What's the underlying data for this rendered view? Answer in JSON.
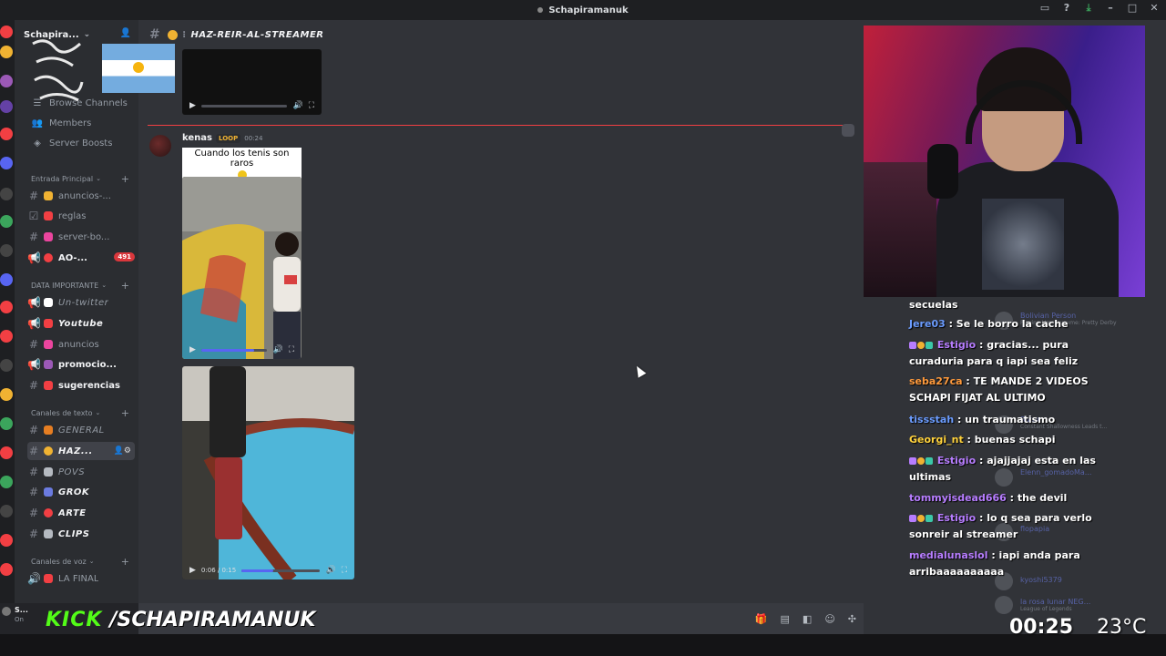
{
  "window": {
    "title": "Schapiramanuk"
  },
  "server": {
    "name": "Schapira...",
    "chevron": "chevron-down-icon"
  },
  "nav": [
    {
      "label": "Browse Channels",
      "icon": "browse-icon"
    },
    {
      "label": "Members",
      "icon": "members-icon"
    },
    {
      "label": "Server Boosts",
      "icon": "boost-icon"
    }
  ],
  "categories": {
    "entrada": "Entrada Principal",
    "importante": "DATA IMPORTANTE",
    "texto": "Canales de texto",
    "voz": "Canales de voz"
  },
  "channels": {
    "entrada": [
      {
        "name": "anuncios-...",
        "color": "#f0b232"
      },
      {
        "name": "reglas",
        "color": "#f23f43"
      },
      {
        "name": "server-bo...",
        "color": "#eb459e"
      },
      {
        "name": "AO-...",
        "color": "#f23f43",
        "badge": "491"
      }
    ],
    "importante": [
      {
        "name": "Un-twitter",
        "color": "#ffffff"
      },
      {
        "name": "Youtube",
        "color": "#f23f43"
      },
      {
        "name": "anuncios",
        "color": "#eb459e"
      },
      {
        "name": "promocio...",
        "color": "#9b59b6"
      },
      {
        "name": "sugerencias",
        "color": "#f23f43"
      }
    ],
    "texto": [
      {
        "name": "GENERAL",
        "color": "#e67e22"
      },
      {
        "name": "HAZ...",
        "color": "#f0b232"
      },
      {
        "name": "POVS",
        "color": "#b5bac1"
      },
      {
        "name": "GROK",
        "color": "#6b7be0"
      },
      {
        "name": "ARTE",
        "color": "#f23f43"
      },
      {
        "name": "CLIPS",
        "color": "#b5bac1"
      }
    ],
    "voz": [
      {
        "name": "LA FINAL",
        "color": "#f23f43"
      }
    ]
  },
  "channel_header": {
    "name": "HAZ-REIR-AL-STREAMER"
  },
  "message": {
    "author": "kenas",
    "tag": "LOOP",
    "time": "00:24",
    "caption": "Cuando los tenis son raros"
  },
  "video2": {
    "time": "0:06 / 0:15"
  },
  "user_panel": {
    "name": "S...",
    "status": "On"
  },
  "overlay": {
    "kick": "KICK",
    "handle": "/SCHAPIRAMANUK",
    "clock": "00:25",
    "temp": "23°C"
  },
  "chat": [
    {
      "user": "",
      "text": "secuelas",
      "color": "#ffffff"
    },
    {
      "user": "Jere03",
      "text": " : Se le borro la cache",
      "color": "#6b9cff"
    },
    {
      "user": "Estigio",
      "text": " : gracias... pura curaduria para q iapi sea feliz",
      "color": "#b77dff",
      "badges": true
    },
    {
      "user": "seba27ca",
      "text": " : TE MANDE 2 VIDEOS SCHAPI FIJAT AL ULTIMO",
      "color": "#ff9a3c"
    },
    {
      "user": "tissstah",
      "text": " : un traumatismo",
      "color": "#6b9cff"
    },
    {
      "user": "Georgi_nt",
      "text": " : buenas schapi",
      "color": "#ffd23c"
    },
    {
      "user": "Estigio",
      "text": " : ajajjajaj esta en las ultimas",
      "color": "#b77dff",
      "badges": true
    },
    {
      "user": "tommyisdead666",
      "text": " : the devil",
      "color": "#b77dff"
    },
    {
      "user": "Estigio",
      "text": " : lo q sea para verlo sonreir al streamer",
      "color": "#b77dff",
      "badges": true
    },
    {
      "user": "medialunaslol",
      "text": " : iapi anda para arribaaaaaaaaaa",
      "color": "#b77dff"
    }
  ],
  "members_ghost": [
    {
      "name": "Bolivian Person",
      "sub": "Playing Umamusume: Pretty Derby"
    },
    {
      "name": "Satan",
      "sub": "Constant Shallowness Leads t..."
    },
    {
      "name": "Elenn_gomadoMa...",
      "sub": ""
    },
    {
      "name": "flopapia",
      "sub": ""
    },
    {
      "name": "kyoshi5379",
      "sub": ""
    },
    {
      "name": "la rosa lunar NEG...",
      "sub": "League of Legends"
    }
  ]
}
